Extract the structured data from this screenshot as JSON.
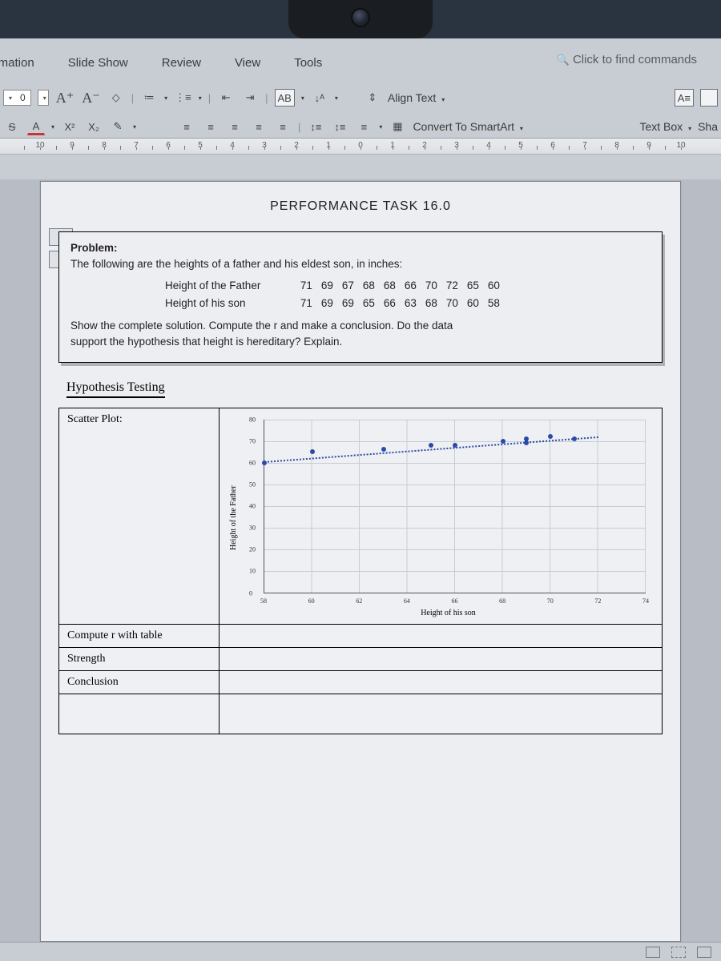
{
  "menu": {
    "tabs": [
      "nimation",
      "Slide Show",
      "Review",
      "View",
      "Tools"
    ],
    "search_placeholder": "Click to find commands"
  },
  "ribbon": {
    "font_size_value": "0",
    "increase_font": "A⁺",
    "decrease_font": "A⁻",
    "clear_fmt": "◇",
    "strike": "S",
    "fontcolor": "A",
    "super": "X²",
    "sub": "X₂",
    "highlighter": "✎",
    "bullets": "≔",
    "numbering": "⋮≡",
    "outdent": "⇤",
    "indent": "⇥",
    "ab": "AB",
    "sort": "↓ᴬ",
    "align_left": "≡",
    "align_center": "≡",
    "align_right": "≡",
    "justify": "≡",
    "distribute": "≡",
    "line_up": "↕≡",
    "line_down": "↕≡",
    "line_sp": "≡",
    "align_text_label": "Align Text",
    "convert_label": "Convert To SmartArt",
    "textbox_label": "Text Box",
    "shapes_label": "Sha",
    "a_box": "A≡"
  },
  "ruler_numbers": [
    "10",
    "9",
    "8",
    "7",
    "6",
    "5",
    "4",
    "3",
    "2",
    "1",
    "0",
    "1",
    "2",
    "3",
    "4",
    "5",
    "6",
    "7",
    "8",
    "9",
    "10"
  ],
  "document": {
    "title": "PERFORMANCE TASK 16.0",
    "problem_label": "Problem:",
    "problem_intro": "The following are the heights of a father and his eldest son, in inches:",
    "row1_label": "Height of the Father",
    "row1_values": [
      "71",
      "69",
      "67",
      "68",
      "68",
      "66",
      "70",
      "72",
      "65",
      "60"
    ],
    "row2_label": "Height of his son",
    "row2_values": [
      "71",
      "69",
      "69",
      "65",
      "66",
      "63",
      "68",
      "70",
      "60",
      "58"
    ],
    "problem_tail1": "Show the complete solution. Compute the r and make a conclusion. Do the data",
    "problem_tail2": "support the hypothesis that height is hereditary? Explain.",
    "hyp_label": "Hypothesis Testing",
    "scatter_label": "Scatter Plot:",
    "compute_label": "Compute r with table",
    "strength_label": "Strength",
    "conclusion_label": "Conclusion"
  },
  "chart_data": {
    "type": "scatter",
    "xlabel": "Height of his son",
    "ylabel": "Height of the Father",
    "xlim": [
      58,
      74
    ],
    "ylim": [
      0,
      80
    ],
    "xticks": [
      58,
      60,
      62,
      64,
      66,
      68,
      70,
      72,
      74
    ],
    "yticks": [
      0,
      10,
      20,
      30,
      40,
      50,
      60,
      70,
      80
    ],
    "points": [
      {
        "x": 58,
        "y": 60
      },
      {
        "x": 60,
        "y": 65
      },
      {
        "x": 63,
        "y": 66
      },
      {
        "x": 65,
        "y": 68
      },
      {
        "x": 66,
        "y": 68
      },
      {
        "x": 68,
        "y": 70
      },
      {
        "x": 69,
        "y": 69
      },
      {
        "x": 69,
        "y": 71
      },
      {
        "x": 70,
        "y": 72
      },
      {
        "x": 71,
        "y": 71
      }
    ],
    "trend": {
      "x0": 58,
      "y0": 60.5,
      "x1": 72,
      "y1": 72
    }
  }
}
